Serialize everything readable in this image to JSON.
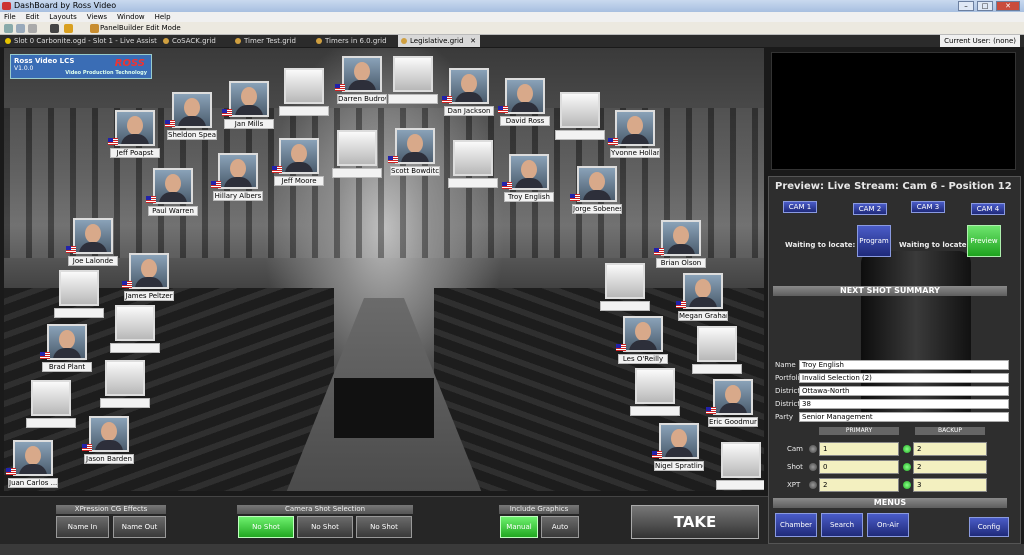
{
  "window": {
    "title": "DashBoard by Ross Video"
  },
  "menu": [
    "File",
    "Edit",
    "Layouts",
    "Views",
    "Window",
    "Help"
  ],
  "toolbar": {
    "panelbuilder": "PanelBuilder Edit Mode"
  },
  "tabs": [
    {
      "label": "Slot 0 Carbonite.ogd - Slot 1 - Live Assist"
    },
    {
      "label": "CoSACK.grid"
    },
    {
      "label": "Timer Test.grid"
    },
    {
      "label": "Timers in 6.0.grid"
    },
    {
      "label": "Legislative.grid"
    }
  ],
  "current_user": "Current User: (none)",
  "logo": {
    "title": "Ross Video LCS",
    "version": "V1.0.0",
    "brand": "ROSS",
    "sub": "Video Production Technology"
  },
  "seats": [
    {
      "name": "Darren Budrow",
      "occupied": true
    },
    {
      "name": "",
      "occupied": false
    },
    {
      "name": "",
      "occupied": false
    },
    {
      "name": "Dan Jackson",
      "occupied": true
    },
    {
      "name": "David Ross",
      "occupied": true
    },
    {
      "name": "Jan Mills",
      "occupied": true
    },
    {
      "name": "Sheldon Spear",
      "occupied": true
    },
    {
      "name": "Jeff Poapst",
      "occupied": true
    },
    {
      "name": "",
      "occupied": false
    },
    {
      "name": "Yvonne Holland",
      "occupied": true
    },
    {
      "name": "Jeff Moore",
      "occupied": true
    },
    {
      "name": "",
      "occupied": false
    },
    {
      "name": "Scott Bowditch",
      "occupied": true
    },
    {
      "name": "",
      "occupied": false
    },
    {
      "name": "Hillary Albers",
      "occupied": true
    },
    {
      "name": "Paul Warren",
      "occupied": true
    },
    {
      "name": "Troy English",
      "occupied": true
    },
    {
      "name": "Jorge Sobenes",
      "occupied": true
    },
    {
      "name": "Joe Lalonde",
      "occupied": true
    },
    {
      "name": "Brian Olson",
      "occupied": true
    },
    {
      "name": "James Peltzer",
      "occupied": true
    },
    {
      "name": "",
      "occupied": false
    },
    {
      "name": "",
      "occupied": false
    },
    {
      "name": "Megan Graham",
      "occupied": true
    },
    {
      "name": "",
      "occupied": false
    },
    {
      "name": "Les O'Reilly",
      "occupied": true
    },
    {
      "name": "Brad Plant",
      "occupied": true
    },
    {
      "name": "",
      "occupied": false
    },
    {
      "name": "",
      "occupied": false
    },
    {
      "name": "",
      "occupied": false
    },
    {
      "name": "",
      "occupied": false
    },
    {
      "name": "Eric Goodmur...",
      "occupied": true
    },
    {
      "name": "Jason Barden",
      "occupied": true
    },
    {
      "name": "Nigel Spratling",
      "occupied": true
    },
    {
      "name": "Juan Carlos ...",
      "occupied": true
    },
    {
      "name": "",
      "occupied": false
    }
  ],
  "preview": {
    "title": "Preview: Live Stream: Cam 6 - Position 12",
    "cams": [
      "CAM 1",
      "CAM 2",
      "CAM 3",
      "CAM 4"
    ],
    "waiting": "Waiting to locate:",
    "program_label": "Program",
    "preview_label": "Preview",
    "next_shot_summary": "NEXT SHOT SUMMARY",
    "fields": [
      {
        "label": "Name",
        "value": "Troy English"
      },
      {
        "label": "Portfolio",
        "value": "Invalid Selection (2)"
      },
      {
        "label": "District",
        "value": "Ottawa-North"
      },
      {
        "label": "District#",
        "value": "38"
      },
      {
        "label": "Party",
        "value": "Senior Management"
      }
    ],
    "primary": "PRIMARY",
    "backup": "BACKUP",
    "rows": [
      {
        "label": "Cam",
        "primary": "1",
        "backup": "2"
      },
      {
        "label": "Shot",
        "primary": "0",
        "backup": "2"
      },
      {
        "label": "XPT",
        "primary": "2",
        "backup": "3"
      }
    ],
    "menus_title": "MENUS",
    "menus": [
      "Chamber",
      "Search",
      "On-Air"
    ],
    "config": "Config"
  },
  "bottom": {
    "xpression": {
      "title": "XPression CG Effects",
      "buttons": [
        "Name In",
        "Name Out"
      ]
    },
    "camera_shot": {
      "title": "Camera Shot Selection",
      "buttons": [
        "No Shot",
        "No Shot",
        "No Shot"
      ]
    },
    "include_graphics": {
      "title": "Include Graphics",
      "buttons": [
        "Manual",
        "Auto"
      ]
    },
    "take": "TAKE"
  }
}
